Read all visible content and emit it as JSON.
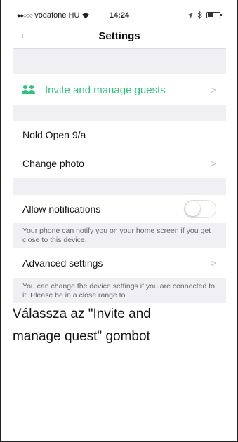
{
  "statusbar": {
    "signal_dots": "●●○○○",
    "carrier": "vodafone HU",
    "wifi_icon": "wifi-icon",
    "time": "14:24",
    "location_icon": "location-arrow-icon",
    "bluetooth_icon": "bluetooth-icon",
    "battery_icon": "battery-icon"
  },
  "navbar": {
    "back_glyph": "←",
    "title": "Settings"
  },
  "settings": {
    "invite_label": "Invite and manage guests",
    "device_name": "Nold Open 9/a",
    "change_photo_label": "Change photo",
    "allow_notifications_label": "Allow notifications",
    "allow_notifications_on": false,
    "notifications_hint": "Your phone can notify you on your home screen if you get close to this device.",
    "advanced_label": "Advanced settings",
    "advanced_hint": "You can change the device settings if you are connected to it. Please be in a close range to"
  },
  "chevron": ">",
  "colors": {
    "accent": "#2ec27e",
    "background": "#f0f0f4"
  },
  "caption": {
    "line1": "Válassza az \"Invite and",
    "line2": "manage quest\" gombot"
  }
}
